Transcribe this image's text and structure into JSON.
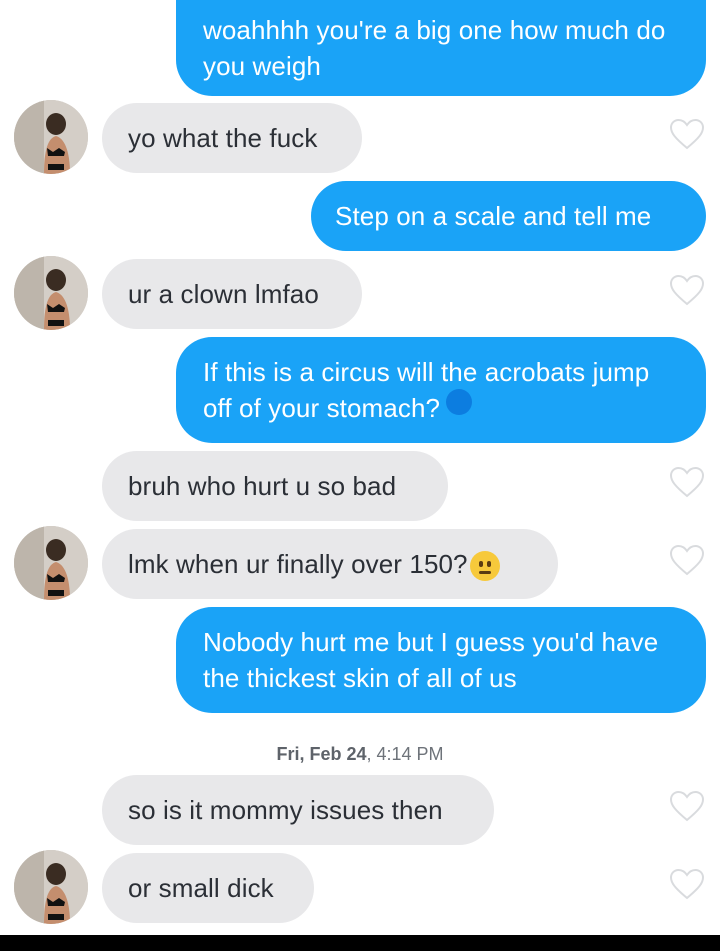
{
  "colors": {
    "sent_bubble": "#1aa3f7",
    "received_bubble": "#e8e8ea",
    "timestamp_text": "#6e737a"
  },
  "messages": [
    {
      "direction": "sent",
      "text": "woahhhh you're a big one how much do you weigh"
    },
    {
      "direction": "received",
      "text": "yo what the fuck",
      "avatar": true
    },
    {
      "direction": "sent",
      "text": "Step on a scale and tell me"
    },
    {
      "direction": "received",
      "text": "ur a clown lmfao",
      "avatar": true
    },
    {
      "direction": "sent",
      "text": "If this is a circus will the acrobats jump off of your stomach?"
    },
    {
      "direction": "received",
      "text": "bruh who hurt u so bad",
      "avatar": false
    },
    {
      "direction": "received",
      "text": "lmk when ur finally over 150?",
      "avatar": true,
      "emoji": "face-with-hand-over-mouth-icon"
    },
    {
      "direction": "sent",
      "text": "Nobody hurt me but I guess you'd have the thickest skin of all of us"
    },
    {
      "direction": "received",
      "text": "so is it mommy issues then",
      "avatar": false
    },
    {
      "direction": "received",
      "text": "or small dick",
      "avatar": true
    }
  ],
  "timestamp": {
    "day": "Fri, Feb 24",
    "time": ", 4:14 PM"
  },
  "icons": {
    "like": "heart-outline-icon",
    "read_receipt": "read-dot-icon"
  }
}
